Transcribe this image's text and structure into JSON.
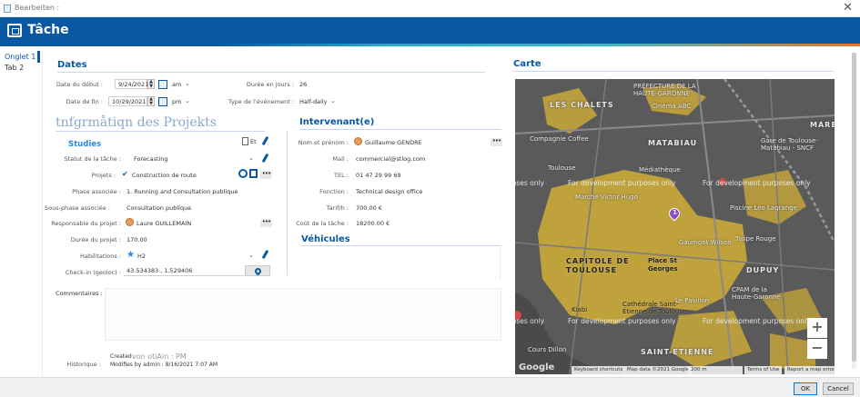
{
  "window": {
    "title": "Bearbeiten :"
  },
  "header": {
    "title": "Tâche"
  },
  "tabs": [
    {
      "label": "Onglet 1"
    },
    {
      "label": "Tab 2"
    }
  ],
  "dates": {
    "section_title": "Dates",
    "start_label": "Date du début :",
    "start_value": "9/24/2021",
    "start_ampm": "am",
    "end_label": "Date de fin :",
    "end_value": "10/29/2021",
    "end_ampm": "pm",
    "duration_label": "Durée en jours :",
    "duration_value": "26",
    "event_type_label": "Type de l'événement :",
    "event_type_value": "Half-daily"
  },
  "projects": {
    "section_title": "tnfgrmåtiqn des Projekts",
    "subsection": "Studies",
    "badge": "Et",
    "status_label": "Statut de la tâche :",
    "status_value": "Forecasting",
    "projects_label": "Projets :",
    "projects_value": "Construction de route",
    "phase_label": "Phase associée :",
    "phase_value": "1. Running and Consultation publique",
    "subphase_label": "Sous-phase associée :",
    "subphase_value": "Consultation publique",
    "manager_label": "Responsable du projet :",
    "manager_value": "Laure GUILLEMAIN",
    "project_duration_label": "Durée du projet :",
    "project_duration_value": "170.00",
    "habilitations_label": "Habilitations :",
    "habilitations_value": "H2",
    "checkin_label": "Check-in (geoloc) :",
    "checkin_value": "43.534383 , 1.529406"
  },
  "intervenant": {
    "section_title": "Intervenant(e)",
    "name_label": "Nom et prénom :",
    "name_value": "Guillaume GENDRE",
    "mail_label": "Mail :",
    "mail_value": "commercial@stlog.com",
    "tel_label": "TEL :",
    "tel_value": "01 47 29 99 69",
    "function_label": "Fonction :",
    "function_value": "Technical design office",
    "rate_label": "Tarif/h :",
    "rate_value": "700.00 €",
    "cost_label": "Coût de la tâche :",
    "cost_value": "18200.00 €"
  },
  "vehicules": {
    "section_title": "Véhicules"
  },
  "comments": {
    "label": "Commentaires :"
  },
  "history": {
    "label": "Historique :",
    "line1": "Created",
    "line1_overlay": "von otiAin : PM",
    "line2": "Modifies by admin : 8/16/2021 7:07 AM"
  },
  "map": {
    "title": "Carte",
    "watermark": "For development purposes only",
    "watermark_short": "poses only",
    "places": {
      "chalets": "LES CHALETS",
      "matabiau": "MATABIAU",
      "marengo": "MAREN",
      "capitole": "CAPITOLE DE\nTOULOUSE",
      "dupuy": "DUPUY",
      "st_etienne": "SAINT-ETIENNE",
      "place_st_georges": "Place St\nGeorges",
      "gaumont": "Gaumont Wilson",
      "piscine": "Piscine Léo Lagrange",
      "pavillon": "Le Pavillon",
      "cathedrale": "Cathédrale Saint-\nÉtienne de Toulouse",
      "kiabi": "Kiabi",
      "cpam": "CPAM de la\nHaute-Garonne",
      "gare": "Gare de Toulouse-\nMatabiau - SNCF",
      "efr": "Cinéma ABC",
      "compagnie": "Compagnie Coffee",
      "prefecture": "PRÉFECTURE DE LA\nHAUTE-GARONNE",
      "mediatheque": "Médiathèque",
      "marche": "Marché Victor Hugo",
      "toulouse": "Toulouse",
      "cours": "Cours Dillon",
      "tulipe": "Tulipe Rouge"
    },
    "google": "Google",
    "attribution": {
      "shortcuts": "Keyboard shortcuts",
      "data": "Map data ©2021 Google",
      "scale": "200 m",
      "terms": "Terms of Use",
      "report": "Report a map error"
    },
    "zoom_in": "+",
    "zoom_out": "−",
    "marker_number": "1"
  },
  "footer": {
    "ok": "OK",
    "cancel": "Cancel"
  },
  "colors": {
    "brand": "#0a58a3",
    "map_yellow": "#c9a83a",
    "map_dark": "#5a5a5a"
  }
}
